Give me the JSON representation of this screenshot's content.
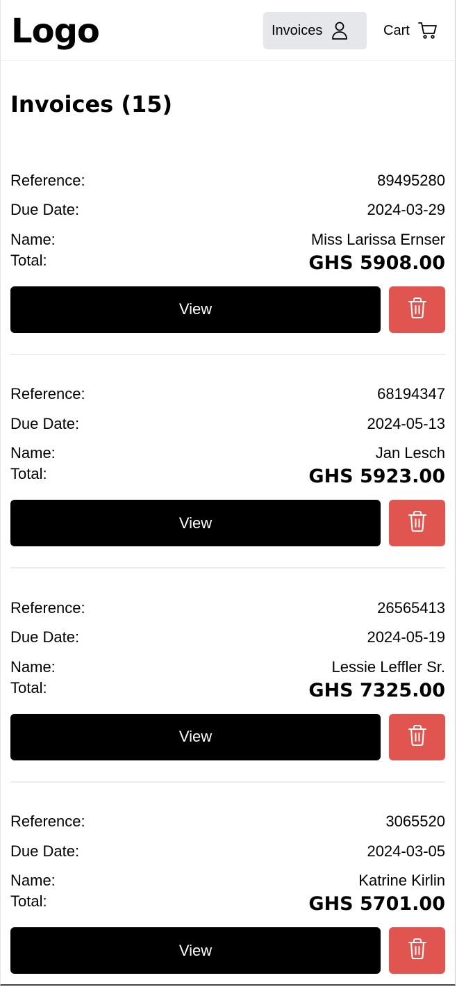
{
  "header": {
    "logo": "Logo",
    "nav": {
      "invoices_label": "Invoices",
      "cart_label": "Cart"
    }
  },
  "page": {
    "title": "Invoices (15)"
  },
  "labels": {
    "reference": "Reference:",
    "due_date": "Due Date:",
    "name": "Name:",
    "total": "Total:",
    "view": "View"
  },
  "invoices": [
    {
      "reference": "89495280",
      "due_date": "2024-03-29",
      "name": "Miss Larissa Ernser",
      "total": "GHS 5908.00"
    },
    {
      "reference": "68194347",
      "due_date": "2024-05-13",
      "name": "Jan Lesch",
      "total": "GHS 5923.00"
    },
    {
      "reference": "26565413",
      "due_date": "2024-05-19",
      "name": "Lessie Leffler Sr.",
      "total": "GHS 7325.00"
    },
    {
      "reference": "3065520",
      "due_date": "2024-03-05",
      "name": "Katrine Kirlin",
      "total": "GHS 5701.00"
    }
  ],
  "colors": {
    "view_button": "#000000",
    "delete_button": "#e05550",
    "nav_active": "#e6e7ea"
  },
  "icons": {
    "user": "user-icon",
    "cart": "cart-icon",
    "trash": "trash-icon"
  }
}
